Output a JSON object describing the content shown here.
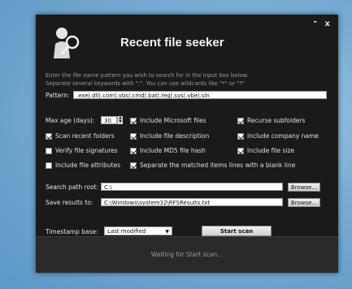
{
  "window": {
    "title": "Recent file seeker",
    "controls": {
      "minimize": "-",
      "close": "x"
    }
  },
  "description": [
    "Enter the file name pattern you wish to search for in the input box below.",
    "Separate several keywords with \";\". You can use wildcards like \"*\" or \"?\""
  ],
  "pattern": {
    "label": "Pattern:",
    "value": ".exe|.dll|.com|.vbs|.cmd|.bat|.reg|.sys|.vbe|.sln"
  },
  "max_age": {
    "label": "Max age (days):",
    "value": "30"
  },
  "options": [
    {
      "label": "Include Microsoft files",
      "checked": true
    },
    {
      "label": "Recurse subfolders",
      "checked": true
    },
    {
      "label": "Scan recent folders",
      "checked": true
    },
    {
      "label": "Include file description",
      "checked": true
    },
    {
      "label": "Include company name",
      "checked": true
    },
    {
      "label": "Verify file signatures",
      "checked": false
    },
    {
      "label": "Include MD5 file hash",
      "checked": true
    },
    {
      "label": "Include file size",
      "checked": true
    },
    {
      "label": "Include file attributes",
      "checked": false
    },
    {
      "label": "Separate the matched items lines with a blank line",
      "checked": true
    }
  ],
  "search_path": {
    "label": "Search path root:",
    "value": "C:\\",
    "browse": "Browse..."
  },
  "save_results": {
    "label": "Save results to:",
    "value": "C:\\Windows\\system32\\RFSResults.txt",
    "browse": "Browse..."
  },
  "timestamp": {
    "label": "Timestamp base:",
    "value": "Last modified"
  },
  "start_button": "Start scan",
  "status": "Waiting for Start scan..."
}
